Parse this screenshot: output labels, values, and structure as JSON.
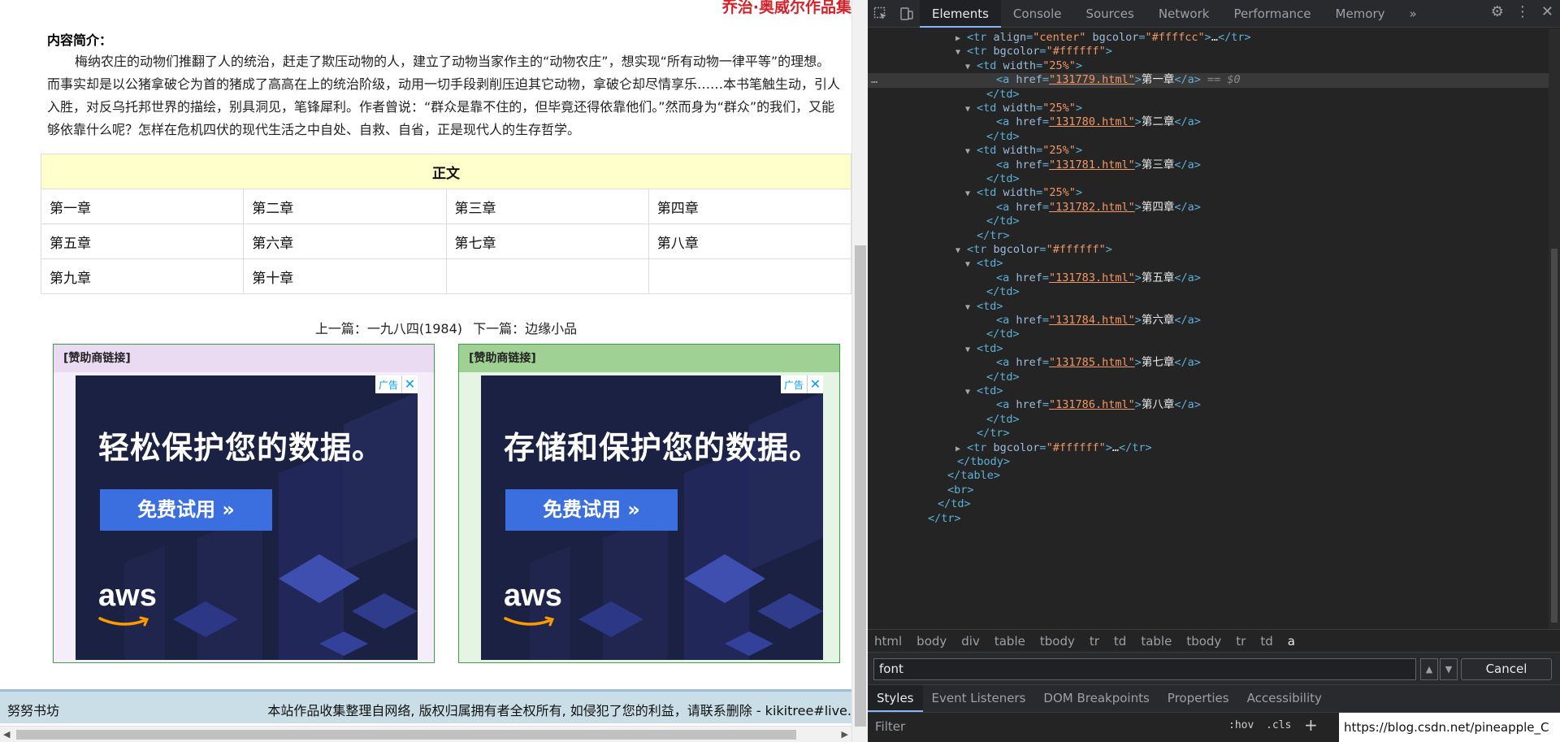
{
  "page": {
    "top_title": "乔治·奥威尔作品集",
    "intro_label": "内容简介：",
    "intro_text": "梅纳农庄的动物们推翻了人的统治，赶走了欺压动物的人，建立了动物当家作主的“动物农庄”，想实现“所有动物一律平等”的理想。而事实却是以公猪拿破仑为首的猪成了高高在上的统治阶级，动用一切手段剥削压迫其它动物，拿破仑却尽情享乐……本书笔触生动，引人入胜，对反乌托邦世界的描绘，别具洞见，笔锋犀利。作者曾说：“群众是靠不住的，但毕竟还得依靠他们。”然而身为“群众”的我们，又能够依靠什么呢？怎样在危机四伏的现代生活之中自处、自救、自省，正是现代人的生存哲学。",
    "table_header": "正文",
    "chapters": [
      [
        "第一章",
        "第二章",
        "第三章",
        "第四章"
      ],
      [
        "第五章",
        "第六章",
        "第七章",
        "第八章"
      ],
      [
        "第九章",
        "第十章",
        "",
        ""
      ]
    ],
    "prev_label": "上一篇：一九八四(1984)",
    "next_label": "下一篇：边缘小品",
    "ads": [
      {
        "header": "[赞助商链接]",
        "slogan": "轻松保护您的数据。",
        "button": "免费试用 »",
        "logo": "aws",
        "badge": "广告",
        "close": "✕"
      },
      {
        "header": "[赞助商链接]",
        "slogan": "存储和保护您的数据。",
        "button": "免费试用 »",
        "logo": "aws",
        "badge": "广告",
        "close": "✕"
      }
    ],
    "footer_site": "努努书坊",
    "footer_notice": "本站作品收集整理自网络, 版权归属拥有者全权所有, 如侵犯了您的利益，请联系删除 - kikitree#live."
  },
  "devtools": {
    "tabs": [
      "Elements",
      "Console",
      "Sources",
      "Network",
      "Performance",
      "Memory"
    ],
    "more": "»",
    "dom_lines": [
      {
        "indent": 9,
        "tri": "▶",
        "html": [
          [
            "tag",
            "<tr "
          ],
          [
            "attr",
            "align"
          ],
          [
            "tag",
            "="
          ],
          [
            "val",
            "\"center\""
          ],
          [
            "tag",
            " "
          ],
          [
            "attr",
            "bgcolor"
          ],
          [
            "tag",
            "="
          ],
          [
            "val",
            "\"#ffffcc\""
          ],
          [
            "tag",
            ">"
          ],
          [
            "text",
            "…"
          ],
          [
            "tag",
            "</tr>"
          ]
        ]
      },
      {
        "indent": 9,
        "tri": "▼",
        "html": [
          [
            "tag",
            "<tr "
          ],
          [
            "attr",
            "bgcolor"
          ],
          [
            "tag",
            "="
          ],
          [
            "val",
            "\"#ffffff\""
          ],
          [
            "tag",
            ">"
          ]
        ]
      },
      {
        "indent": 10,
        "tri": "▼",
        "html": [
          [
            "tag",
            "<td "
          ],
          [
            "attr",
            "width"
          ],
          [
            "tag",
            "="
          ],
          [
            "val",
            "\"25%\""
          ],
          [
            "tag",
            ">"
          ]
        ]
      },
      {
        "indent": 12,
        "tri": "",
        "sel": true,
        "html": [
          [
            "tag",
            "<a "
          ],
          [
            "attr",
            "href"
          ],
          [
            "tag",
            "="
          ],
          [
            "link",
            "\"131779.html\""
          ],
          [
            "tag",
            ">"
          ],
          [
            "text",
            "第一章"
          ],
          [
            "tag",
            "</a>"
          ],
          [
            "eq",
            " == $0"
          ]
        ]
      },
      {
        "indent": 11,
        "tri": "",
        "html": [
          [
            "tag",
            "</td>"
          ]
        ]
      },
      {
        "indent": 10,
        "tri": "▼",
        "html": [
          [
            "tag",
            "<td "
          ],
          [
            "attr",
            "width"
          ],
          [
            "tag",
            "="
          ],
          [
            "val",
            "\"25%\""
          ],
          [
            "tag",
            ">"
          ]
        ]
      },
      {
        "indent": 12,
        "tri": "",
        "html": [
          [
            "tag",
            "<a "
          ],
          [
            "attr",
            "href"
          ],
          [
            "tag",
            "="
          ],
          [
            "link",
            "\"131780.html\""
          ],
          [
            "tag",
            ">"
          ],
          [
            "text",
            "第二章"
          ],
          [
            "tag",
            "</a>"
          ]
        ]
      },
      {
        "indent": 11,
        "tri": "",
        "html": [
          [
            "tag",
            "</td>"
          ]
        ]
      },
      {
        "indent": 10,
        "tri": "▼",
        "html": [
          [
            "tag",
            "<td "
          ],
          [
            "attr",
            "width"
          ],
          [
            "tag",
            "="
          ],
          [
            "val",
            "\"25%\""
          ],
          [
            "tag",
            ">"
          ]
        ]
      },
      {
        "indent": 12,
        "tri": "",
        "html": [
          [
            "tag",
            "<a "
          ],
          [
            "attr",
            "href"
          ],
          [
            "tag",
            "="
          ],
          [
            "link",
            "\"131781.html\""
          ],
          [
            "tag",
            ">"
          ],
          [
            "text",
            "第三章"
          ],
          [
            "tag",
            "</a>"
          ]
        ]
      },
      {
        "indent": 11,
        "tri": "",
        "html": [
          [
            "tag",
            "</td>"
          ]
        ]
      },
      {
        "indent": 10,
        "tri": "▼",
        "html": [
          [
            "tag",
            "<td "
          ],
          [
            "attr",
            "width"
          ],
          [
            "tag",
            "="
          ],
          [
            "val",
            "\"25%\""
          ],
          [
            "tag",
            ">"
          ]
        ]
      },
      {
        "indent": 12,
        "tri": "",
        "html": [
          [
            "tag",
            "<a "
          ],
          [
            "attr",
            "href"
          ],
          [
            "tag",
            "="
          ],
          [
            "link",
            "\"131782.html\""
          ],
          [
            "tag",
            ">"
          ],
          [
            "text",
            "第四章"
          ],
          [
            "tag",
            "</a>"
          ]
        ]
      },
      {
        "indent": 11,
        "tri": "",
        "html": [
          [
            "tag",
            "</td>"
          ]
        ]
      },
      {
        "indent": 10,
        "tri": "",
        "html": [
          [
            "tag",
            "</tr>"
          ]
        ]
      },
      {
        "indent": 9,
        "tri": "▼",
        "html": [
          [
            "tag",
            "<tr "
          ],
          [
            "attr",
            "bgcolor"
          ],
          [
            "tag",
            "="
          ],
          [
            "val",
            "\"#ffffff\""
          ],
          [
            "tag",
            ">"
          ]
        ]
      },
      {
        "indent": 10,
        "tri": "▼",
        "html": [
          [
            "tag",
            "<td>"
          ]
        ]
      },
      {
        "indent": 12,
        "tri": "",
        "html": [
          [
            "tag",
            "<a "
          ],
          [
            "attr",
            "href"
          ],
          [
            "tag",
            "="
          ],
          [
            "link",
            "\"131783.html\""
          ],
          [
            "tag",
            ">"
          ],
          [
            "text",
            "第五章"
          ],
          [
            "tag",
            "</a>"
          ]
        ]
      },
      {
        "indent": 11,
        "tri": "",
        "html": [
          [
            "tag",
            "</td>"
          ]
        ]
      },
      {
        "indent": 10,
        "tri": "▼",
        "html": [
          [
            "tag",
            "<td>"
          ]
        ]
      },
      {
        "indent": 12,
        "tri": "",
        "html": [
          [
            "tag",
            "<a "
          ],
          [
            "attr",
            "href"
          ],
          [
            "tag",
            "="
          ],
          [
            "link",
            "\"131784.html\""
          ],
          [
            "tag",
            ">"
          ],
          [
            "text",
            "第六章"
          ],
          [
            "tag",
            "</a>"
          ]
        ]
      },
      {
        "indent": 11,
        "tri": "",
        "html": [
          [
            "tag",
            "</td>"
          ]
        ]
      },
      {
        "indent": 10,
        "tri": "▼",
        "html": [
          [
            "tag",
            "<td>"
          ]
        ]
      },
      {
        "indent": 12,
        "tri": "",
        "html": [
          [
            "tag",
            "<a "
          ],
          [
            "attr",
            "href"
          ],
          [
            "tag",
            "="
          ],
          [
            "link",
            "\"131785.html\""
          ],
          [
            "tag",
            ">"
          ],
          [
            "text",
            "第七章"
          ],
          [
            "tag",
            "</a>"
          ]
        ]
      },
      {
        "indent": 11,
        "tri": "",
        "html": [
          [
            "tag",
            "</td>"
          ]
        ]
      },
      {
        "indent": 10,
        "tri": "▼",
        "html": [
          [
            "tag",
            "<td>"
          ]
        ]
      },
      {
        "indent": 12,
        "tri": "",
        "html": [
          [
            "tag",
            "<a "
          ],
          [
            "attr",
            "href"
          ],
          [
            "tag",
            "="
          ],
          [
            "link",
            "\"131786.html\""
          ],
          [
            "tag",
            ">"
          ],
          [
            "text",
            "第八章"
          ],
          [
            "tag",
            "</a>"
          ]
        ]
      },
      {
        "indent": 11,
        "tri": "",
        "html": [
          [
            "tag",
            "</td>"
          ]
        ]
      },
      {
        "indent": 10,
        "tri": "",
        "html": [
          [
            "tag",
            "</tr>"
          ]
        ]
      },
      {
        "indent": 9,
        "tri": "▶",
        "html": [
          [
            "tag",
            "<tr "
          ],
          [
            "attr",
            "bgcolor"
          ],
          [
            "tag",
            "="
          ],
          [
            "val",
            "\"#ffffff\""
          ],
          [
            "tag",
            ">"
          ],
          [
            "text",
            "…"
          ],
          [
            "tag",
            "</tr>"
          ]
        ]
      },
      {
        "indent": 8,
        "tri": "",
        "html": [
          [
            "tag",
            "</tbody>"
          ]
        ]
      },
      {
        "indent": 7,
        "tri": "",
        "html": [
          [
            "tag",
            "</table>"
          ]
        ]
      },
      {
        "indent": 7,
        "tri": "",
        "html": [
          [
            "tag",
            "<br>"
          ]
        ]
      },
      {
        "indent": 6,
        "tri": "",
        "html": [
          [
            "tag",
            "</td>"
          ]
        ]
      },
      {
        "indent": 5,
        "tri": "",
        "html": [
          [
            "tag",
            "</tr>"
          ]
        ]
      }
    ],
    "breadcrumbs": [
      "html",
      "body",
      "div",
      "table",
      "tbody",
      "tr",
      "td",
      "table",
      "tbody",
      "tr",
      "td",
      "a"
    ],
    "search_value": "font",
    "cancel_label": "Cancel",
    "subtabs": [
      "Styles",
      "Event Listeners",
      "DOM Breakpoints",
      "Properties",
      "Accessibility"
    ],
    "filter_placeholder": "Filter",
    "hov_label": ":hov",
    "cls_label": ".cls",
    "plus_label": "+",
    "status_url": "https://blog.csdn.net/pineapple_C"
  },
  "colors": {
    "title_red": "#d4232b",
    "table_header_bg": "#ffffcc",
    "devtools_bg": "#242424",
    "devtools_accent": "#8ab4f8"
  }
}
